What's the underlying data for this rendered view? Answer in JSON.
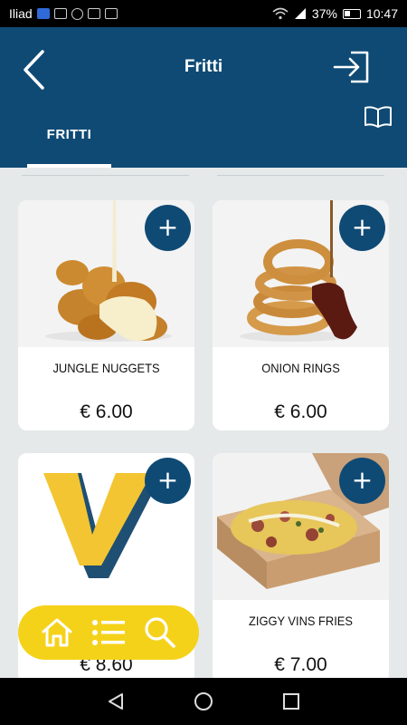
{
  "status_bar": {
    "carrier": "Iliad",
    "battery": "37%",
    "time": "10:47"
  },
  "header": {
    "title": "Fritti",
    "back_icon": "chevron-left-icon",
    "login_icon": "login-icon",
    "menu_icon": "book-icon"
  },
  "tabs": [
    {
      "label": "FRITTI",
      "active": true
    }
  ],
  "products": [
    {
      "name": "JUNGLE NUGGETS",
      "price": "€ 6.00",
      "image": "chicken-nuggets-with-sauce"
    },
    {
      "name": "ONION RINGS",
      "price": "€ 6.00",
      "image": "onion-rings-with-bbq-sauce"
    },
    {
      "name": "",
      "price": "€ 8.60",
      "image": "yellow-v-logo"
    },
    {
      "name": "ZIGGY VINS FRIES",
      "price": "€ 7.00",
      "image": "loaded-fries-box"
    }
  ],
  "add_button": {
    "label": "+"
  },
  "bottom_menu": {
    "items": [
      "home-icon",
      "list-icon",
      "search-icon"
    ]
  },
  "colors": {
    "primary": "#0f4a75",
    "accent": "#f5d21a",
    "background": "#e6e9ea"
  }
}
